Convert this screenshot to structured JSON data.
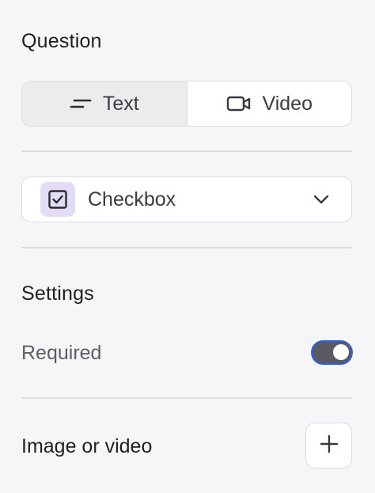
{
  "question": {
    "heading": "Question",
    "modes": [
      {
        "label": "Text",
        "icon": "text-lines-icon",
        "active": true
      },
      {
        "label": "Video",
        "icon": "video-camera-icon",
        "active": false
      }
    ],
    "type_select": {
      "selected": "Checkbox",
      "icon": "checkbox-checked-icon"
    }
  },
  "settings": {
    "heading": "Settings",
    "required_label": "Required",
    "required_on": true
  },
  "media": {
    "label": "Image or video",
    "add_icon": "plus-icon"
  },
  "colors": {
    "accent_border": "#2f5fe0",
    "checkbox_bg": "#e3dcf7",
    "toggle_track": "#5a5a64"
  }
}
